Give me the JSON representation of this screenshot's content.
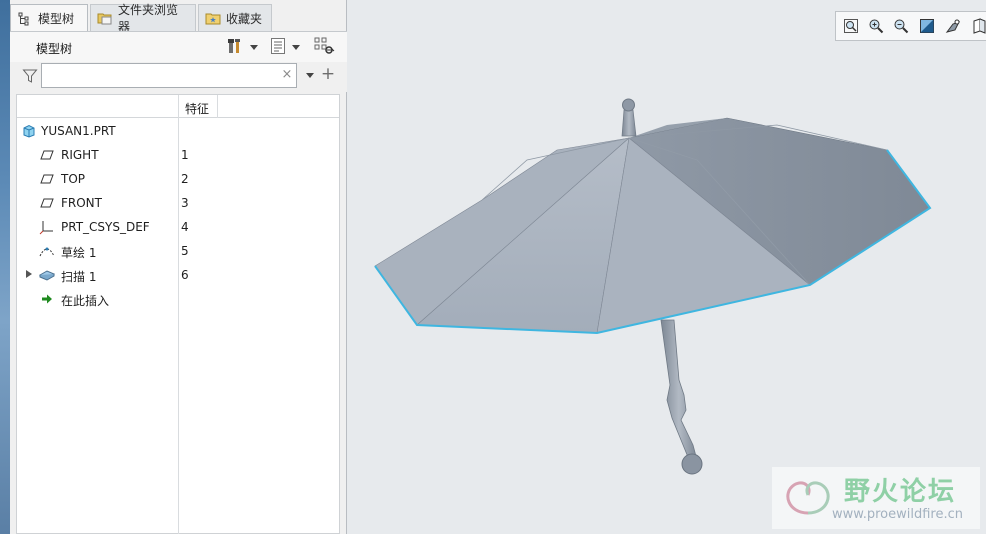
{
  "tabs": [
    {
      "label": "模型树",
      "icon": "model-tree-icon"
    },
    {
      "label": "文件夹浏览器",
      "icon": "folder-browser-icon"
    },
    {
      "label": "收藏夹",
      "icon": "favorites-icon"
    }
  ],
  "tree_header": {
    "title": "模型树"
  },
  "search": {
    "value": "",
    "clear_symbol": "×",
    "add_symbol": "+"
  },
  "table": {
    "column_feature": "特征",
    "rows": [
      {
        "label": "YUSAN1.PRT",
        "number": "",
        "icon": "part-icon"
      },
      {
        "label": "RIGHT",
        "number": "1",
        "icon": "datum-plane-icon"
      },
      {
        "label": "TOP",
        "number": "2",
        "icon": "datum-plane-icon"
      },
      {
        "label": "FRONT",
        "number": "3",
        "icon": "datum-plane-icon"
      },
      {
        "label": "PRT_CSYS_DEF",
        "number": "4",
        "icon": "coordinate-system-icon"
      },
      {
        "label": "草绘 1",
        "number": "5",
        "icon": "sketch-icon"
      },
      {
        "label": "扫描 1",
        "number": "6",
        "icon": "sweep-icon"
      },
      {
        "label": "在此插入",
        "number": "",
        "icon": "insert-here-arrow-icon"
      }
    ]
  },
  "view_toolbar": [
    "zoom-fit-icon",
    "zoom-in-icon",
    "zoom-out-icon",
    "repaint-icon",
    "display-style-icon",
    "saved-views-icon"
  ],
  "watermark": {
    "name": "野火论坛",
    "url": "www.proewildfire.cn"
  },
  "colors": {
    "umbrella_body": "#a8b1bd",
    "edge_highlight": "#3fb6e0",
    "accent_green": "#2a8a2a"
  }
}
